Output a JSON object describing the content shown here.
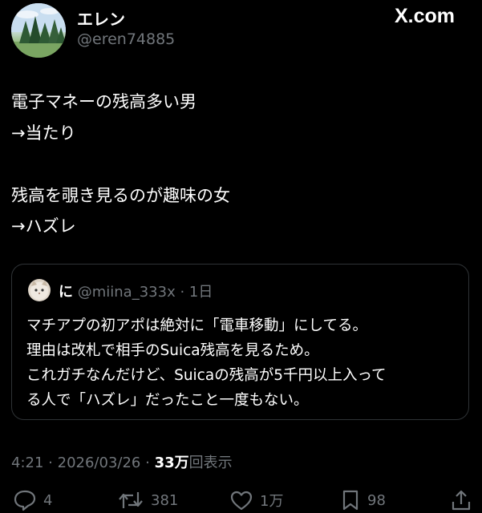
{
  "header": {
    "display_name": "エレン",
    "handle": "@eren74885",
    "watermark": "X.com"
  },
  "post": {
    "lines": [
      "電子マネーの残高多い男",
      "→当たり",
      "残高を覗き見るのが趣味の女",
      "→ハズレ"
    ]
  },
  "quote": {
    "name": "に",
    "handle": "@miina_333x",
    "separator": "·",
    "age": "1日",
    "lines": [
      "マチアプの初アポは絶対に「電車移動」にしてる。",
      "理由は改札で相手のSuica残高を見るため。",
      "これガチなんだけど、Suicaの残高が5千円以上入って",
      "る人で「ハズレ」だったこと一度もない。"
    ]
  },
  "meta": {
    "time": "4:21",
    "date": "2026/03/26",
    "sep": "·",
    "views_count": "33万",
    "views_label": "回表示"
  },
  "actions": {
    "replies": "4",
    "reposts": "381",
    "likes": "1万",
    "bookmarks": "98"
  },
  "colors": {
    "background": "#000000",
    "text": "#ffffff",
    "muted": "#71767b",
    "border": "#2f3336"
  }
}
